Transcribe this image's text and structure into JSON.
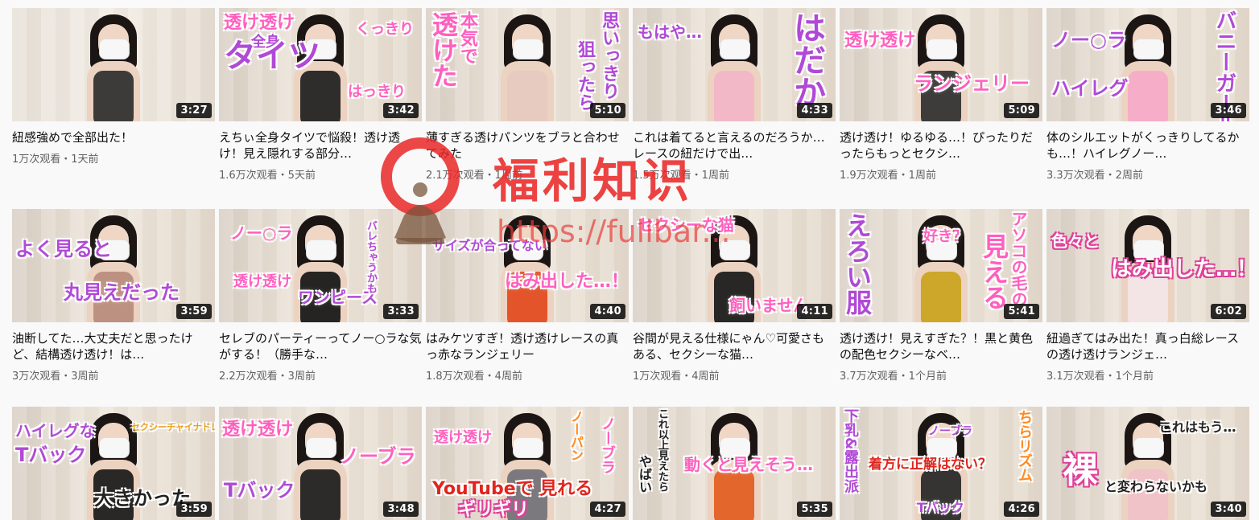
{
  "watermark": {
    "title": "福利知识",
    "url": "https://fulibar...",
    "color": "#e92828"
  },
  "rows": [
    [
      {
        "thumb_caption": [
          "",
          "",
          ""
        ],
        "duration": "3:27",
        "title": "紐感強めで全部出た！",
        "meta": "1万次观看・1天前",
        "outfit": "#2a2a2a"
      },
      {
        "thumb_caption": [
          "透け透け",
          "全身",
          "タイツ",
          "くっきり",
          "はっきり"
        ],
        "duration": "3:42",
        "title": "えちぃ全身タイツで悩殺！透け透け！見え隠れする部分…",
        "meta": "1.6万次观看・5天前",
        "outfit": "#1b1b1b"
      },
      {
        "thumb_caption": [
          "本気で",
          "透けた",
          "思いっきり",
          "狙ったら"
        ],
        "duration": "5:10",
        "title": "薄すぎる透けパンツをブラと合わせてみた",
        "meta": "2.1万次观看・1周前",
        "outfit": "#e7c9c0"
      },
      {
        "thumb_caption": [
          "もはや…",
          "はだか"
        ],
        "duration": "4:33",
        "title": "これは着てると言えるのだろうか…レースの紐だけで出…",
        "meta": "1.5万次观看・1周前",
        "outfit": "#f3b5c9"
      },
      {
        "thumb_caption": [
          "透け透け",
          "ランジェリー"
        ],
        "duration": "5:09",
        "title": "透け透け！ゆるゆる…！ぴったりだったらもっとセクシ…",
        "meta": "1.9万次观看・1周前",
        "outfit": "#2b2b2b"
      },
      {
        "thumb_caption": [
          "ノー○ラ",
          "ハイレグ",
          "バニーガール"
        ],
        "duration": "3:46",
        "title": "体のシルエットがくっきりしてるかも…！ハイレグノー…",
        "meta": "3.3万次观看・2周前",
        "outfit": "#f7a8c8"
      }
    ],
    [
      {
        "thumb_caption": [
          "よく見ると",
          "丸見えだった"
        ],
        "duration": "3:59",
        "title": "油断してた…大丈夫だと思ったけど、結構透け透け！は…",
        "meta": "3万次观看・3周前",
        "outfit": "#b88a7a"
      },
      {
        "thumb_caption": [
          "ノー○ラ",
          "透け透け",
          "ワンピース",
          "バレちゃうかも"
        ],
        "duration": "3:33",
        "title": "セレブのパーティーってノー○ラな気がする！（勝手な…",
        "meta": "2.2万次观看・3周前",
        "outfit": "#111111"
      },
      {
        "thumb_caption": [
          "サイズが合ってない",
          "はみ出した…！"
        ],
        "duration": "4:40",
        "title": "はみケツすぎ！透け透けレースの真っ赤なランジェリー",
        "meta": "1.8万次观看・4周前",
        "outfit": "#e2461a"
      },
      {
        "thumb_caption": [
          "セクシーな猫",
          "飼いません"
        ],
        "duration": "4:11",
        "title": "谷間が見える仕様にゃん♡可愛さもある、セクシーな猫…",
        "meta": "1万次观看・4周前",
        "outfit": "#141414"
      },
      {
        "thumb_caption": [
          "えろい服",
          "好き？",
          "アソコの毛の",
          "見える"
        ],
        "duration": "5:41",
        "title": "透け透け！見えすぎた？！黒と黄色の配色セクシーなベ…",
        "meta": "3.7万次观看・1个月前",
        "outfit": "#c9a21a"
      },
      {
        "thumb_caption": [
          "色々と",
          "はみ出した…！"
        ],
        "duration": "6:02",
        "title": "紐過ぎてはみ出た！真っ白総レースの透け透けランジェ…",
        "meta": "3.1万次观看・1个月前",
        "outfit": "#f4e6ea"
      }
    ],
    [
      {
        "thumb_caption": [
          "ハイレグな",
          "Tバック",
          "セクシーチャイナドレス",
          "大きかった"
        ],
        "duration": "3:59",
        "outfit": "#151515"
      },
      {
        "thumb_caption": [
          "透け透け",
          "Tバック",
          "ノーブラ"
        ],
        "duration": "3:48",
        "outfit": "#181818"
      },
      {
        "thumb_caption": [
          "透け透け",
          "YouTubeで 見れる",
          "ギリギリ",
          "ノーパン",
          "ノーブラ"
        ],
        "duration": "4:27",
        "outfit": "#6f6f75"
      },
      {
        "thumb_caption": [
          "動くと見えそう…",
          "これ以上見えたら",
          "やばい"
        ],
        "duration": "5:35",
        "outfit": "#e25a1c"
      },
      {
        "thumb_caption": [
          "下乳&露出派",
          "ノーブラ",
          "着方に正解はない？",
          "Tバック",
          "ちらリズム"
        ],
        "duration": "4:26",
        "outfit": "#222222"
      },
      {
        "thumb_caption": [
          "これはもう…",
          "裸",
          "と変わらないかも"
        ],
        "duration": "3:40",
        "outfit": "#f1c1c9"
      }
    ]
  ]
}
